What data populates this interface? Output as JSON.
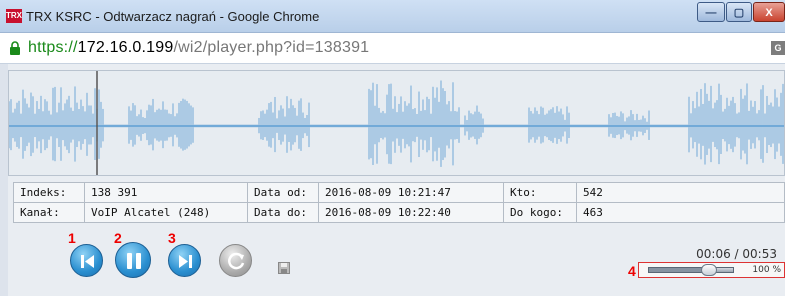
{
  "window": {
    "title": "TRX KSRC - Odtwarzacz nagrań - Google Chrome",
    "app_icon_text": "TRX",
    "minimize_glyph": "—",
    "maximize_glyph": "▢",
    "close_glyph": "X"
  },
  "address": {
    "scheme": "https://",
    "host": "172.16.0.199",
    "path": "/wi2/player.php?id=138391"
  },
  "colors": {
    "waveform": "#8cb9dd",
    "playhead": "#555555",
    "annotation": "#e00000",
    "button_blue": "#2a8fd0"
  },
  "recording": {
    "index_label": "Indeks:",
    "index_value": "138 391",
    "channel_label": "Kanał:",
    "channel_value": "VoIP Alcatel (248)",
    "date_from_label": "Data od:",
    "date_from_value": "2016-08-09 10:21:47",
    "date_to_label": "Data do:",
    "date_to_value": "2016-08-09 10:22:40",
    "who_label": "Kto:",
    "who_value": "542",
    "to_whom_label": "Do kogo:",
    "to_whom_value": "463"
  },
  "player": {
    "time": "00:06 / 00:53",
    "progress_fraction": 0.113,
    "volume_percent": "100 %",
    "volume_fraction": 1.0,
    "annotations": [
      "1",
      "2",
      "3",
      "4"
    ],
    "buttons": [
      "previous-icon",
      "pause-icon",
      "next-icon",
      "reload-icon",
      "save-icon"
    ]
  }
}
